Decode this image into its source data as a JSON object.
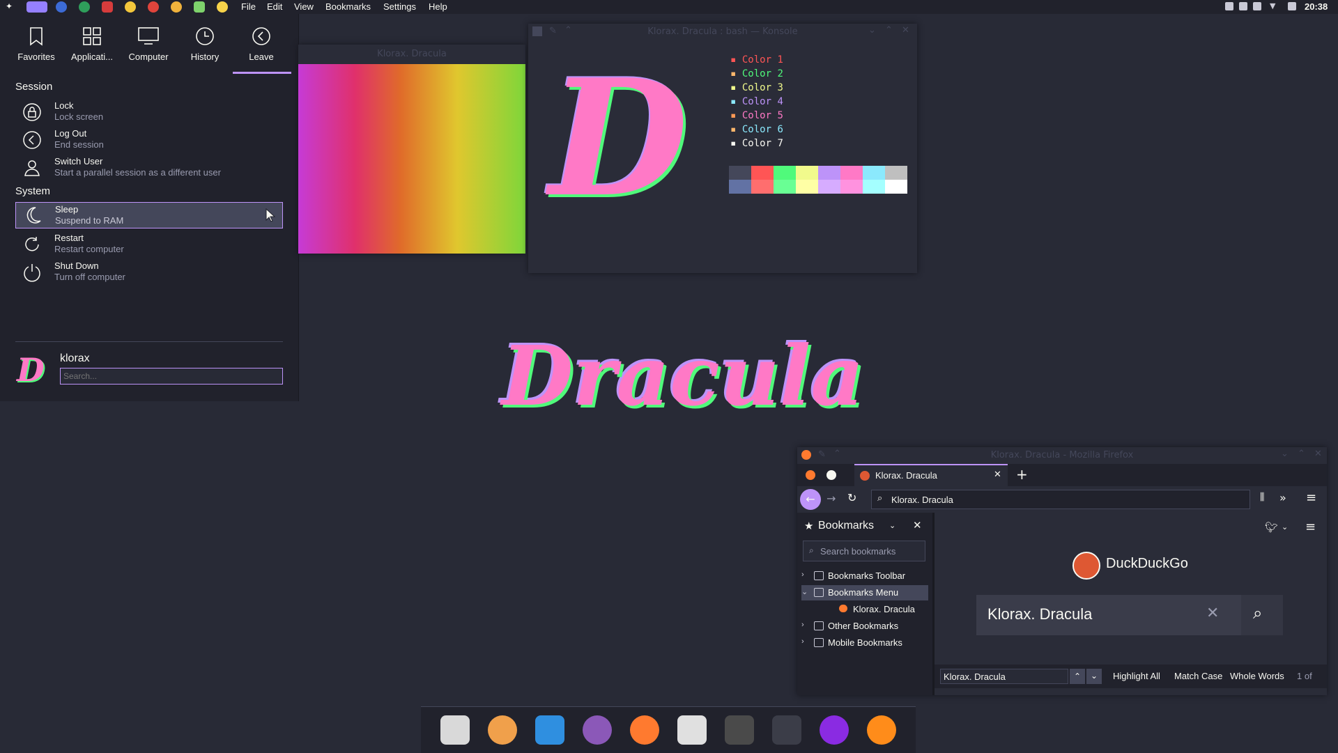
{
  "top_panel": {
    "menus": [
      "File",
      "Edit",
      "View",
      "Bookmarks",
      "Settings",
      "Help"
    ],
    "launchers": [
      "kde-launcher-icon",
      "pin-icon",
      "blue-drop-icon",
      "globe-icon",
      "red-feather-icon",
      "smiley-icon",
      "red-app-icon",
      "sunglasses-icon",
      "pen-icon",
      "bulb-icon"
    ],
    "clock": "20:38"
  },
  "start_menu": {
    "tabs": [
      "Favorites",
      "Applicati...",
      "Computer",
      "History",
      "Leave"
    ],
    "session_title": "Session",
    "session_items": [
      {
        "title": "Lock",
        "subtitle": "Lock screen",
        "icon": "lock-icon"
      },
      {
        "title": "Log Out",
        "subtitle": "End session",
        "icon": "logout-icon"
      },
      {
        "title": "Switch User",
        "subtitle": "Start a parallel session as a different user",
        "icon": "user-icon"
      }
    ],
    "system_title": "System",
    "system_items": [
      {
        "title": "Sleep",
        "subtitle": "Suspend to RAM",
        "icon": "moon-icon"
      },
      {
        "title": "Restart",
        "subtitle": "Restart computer",
        "icon": "restart-icon"
      },
      {
        "title": "Shut Down",
        "subtitle": "Turn off computer",
        "icon": "power-icon"
      }
    ],
    "username": "klorax",
    "search_placeholder": "Search..."
  },
  "wallpaper_window": {
    "title": "Klorax. Dracula"
  },
  "konsole": {
    "title": "Klorax. Dracula : bash — Konsole",
    "colors": [
      {
        "label": "Color 1",
        "color": "#ff5555"
      },
      {
        "label": "Color 2",
        "color": "#50fa7b"
      },
      {
        "label": "Color 3",
        "color": "#f1fa8c"
      },
      {
        "label": "Color 4",
        "color": "#bd93f9"
      },
      {
        "label": "Color 5",
        "color": "#ff79c6"
      },
      {
        "label": "Color 6",
        "color": "#8be9fd"
      },
      {
        "label": "Color 7",
        "color": "#f8f8f2"
      }
    ],
    "swatches_top": [
      "#44475a",
      "#ff5555",
      "#50fa7b",
      "#f1fa8c",
      "#bd93f9",
      "#ff79c6",
      "#8be9fd",
      "#bfbfbf"
    ],
    "swatches_bottom": [
      "#6272a4",
      "#ff6e6e",
      "#69ff94",
      "#ffffa5",
      "#d6acff",
      "#ff92df",
      "#a4ffff",
      "#ffffff"
    ]
  },
  "desktop_logo": "Dracula",
  "firefox": {
    "title": "Klorax. Dracula - Mozilla Firefox",
    "tab_label": "Klorax. Dracula",
    "url": "Klorax. Dracula",
    "sidebar_title": "Bookmarks",
    "sidebar_search_placeholder": "Search bookmarks",
    "bookmarks": [
      {
        "label": "Bookmarks Toolbar",
        "chevron": "›",
        "indent": 0
      },
      {
        "label": "Bookmarks Menu",
        "chevron": "⌄",
        "indent": 0
      },
      {
        "label": "Klorax. Dracula",
        "chevron": "",
        "indent": 1
      },
      {
        "label": "Other Bookmarks",
        "chevron": "›",
        "indent": 0
      },
      {
        "label": "Mobile Bookmarks",
        "chevron": "›",
        "indent": 0
      }
    ],
    "brand": "DuckDuckGo",
    "search_value": "Klorax. Dracula",
    "find_value": "Klorax. Dracula",
    "find_options": [
      "Highlight All",
      "Match Case",
      "Whole Words"
    ],
    "find_count": "1 of"
  },
  "dock": {
    "apps": [
      {
        "name": "archive-icon",
        "color": "#d9d9d9"
      },
      {
        "name": "octopus-icon",
        "color": "#f0a04b"
      },
      {
        "name": "folder-icon",
        "color": "#2f8fe0"
      },
      {
        "name": "emacs-icon",
        "color": "#8b58b8"
      },
      {
        "name": "firefox-icon",
        "color": "#ff7a2f"
      },
      {
        "name": "inkscape-icon",
        "color": "#e0e0e0"
      },
      {
        "name": "calculator-icon",
        "color": "#4a4a4a"
      },
      {
        "name": "terminal-icon",
        "color": "#3b3d48"
      },
      {
        "name": "media-player-icon",
        "color": "#8a2be2"
      },
      {
        "name": "orange-icon",
        "color": "#ff8c1a"
      }
    ]
  }
}
